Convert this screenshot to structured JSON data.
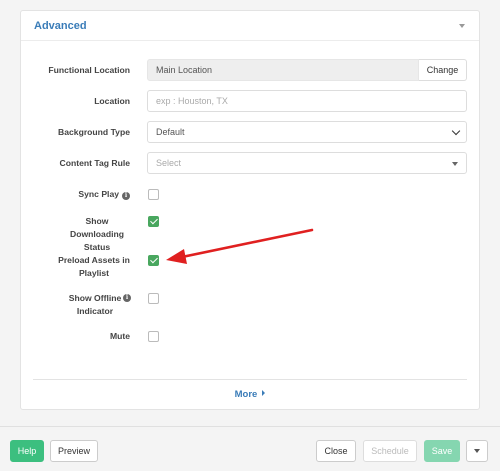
{
  "panel": {
    "title": "Advanced",
    "more_label": "More"
  },
  "fields": {
    "functional_location": {
      "label": "Functional Location",
      "value": "Main Location",
      "button": "Change"
    },
    "location": {
      "label": "Location",
      "placeholder": "exp : Houston, TX"
    },
    "background_type": {
      "label": "Background Type",
      "value": "Default"
    },
    "content_tag_rule": {
      "label": "Content Tag Rule",
      "placeholder": "Select"
    }
  },
  "checkboxes": [
    {
      "label": "Sync Play",
      "info": true,
      "checked": false
    },
    {
      "label": "Show Downloading Status",
      "info": false,
      "checked": true
    },
    {
      "label": "Preload Assets in Playlist",
      "info": false,
      "checked": true
    },
    {
      "label": "Show Offline Indicator",
      "info": true,
      "checked": false
    },
    {
      "label": "Mute",
      "info": false,
      "checked": false
    }
  ],
  "footer": {
    "help": "Help",
    "preview": "Preview",
    "close": "Close",
    "schedule": "Schedule",
    "save": "Save"
  },
  "colors": {
    "accent": "#3a7cb8",
    "checkbox_checked": "#49a75f",
    "help_button": "#3cbf7f",
    "save_button": "#85d6b0",
    "annotation_arrow": "#e02020"
  },
  "icons": {
    "info": "info-icon",
    "collapse": "caret-down-icon",
    "select": "chevron-down-icon"
  }
}
